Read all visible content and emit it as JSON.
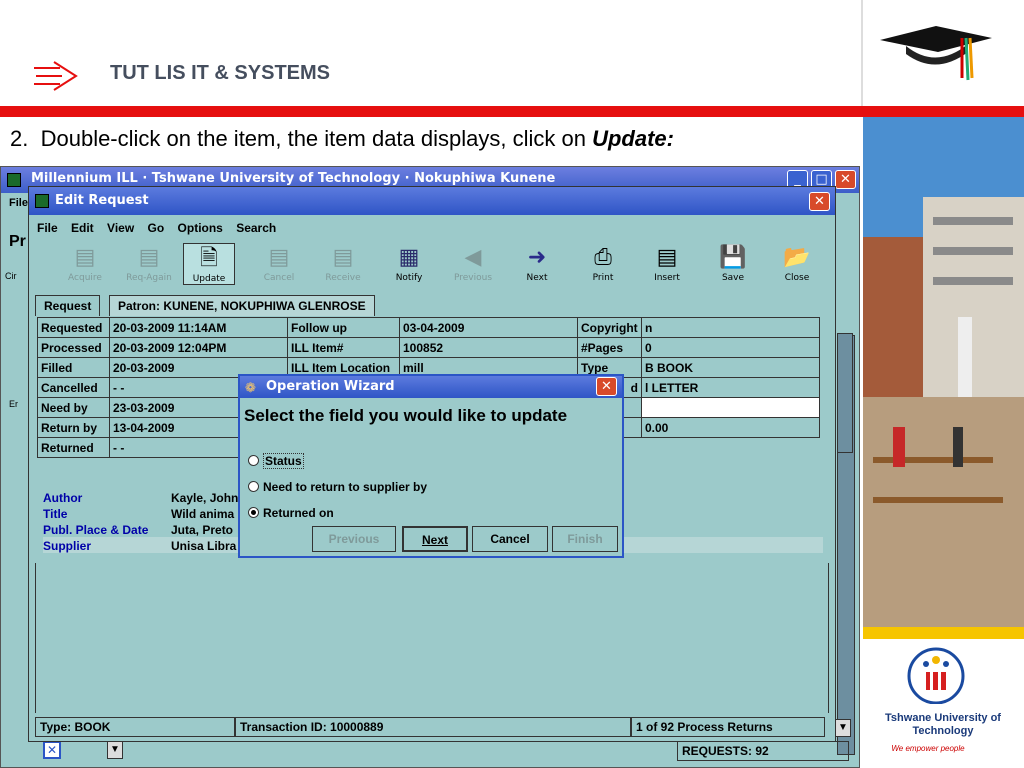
{
  "slide": {
    "title": "TUT LIS IT & SYSTEMS",
    "step_num": "2.",
    "step_text": "Double-click on the item, the item data displays, click on",
    "step_emph": "Update:",
    "logo_name": "Tshwane University of Technology",
    "logo_tagline": "We empower people"
  },
  "window": {
    "title": "Millennium ILL · Tshwane University of Technology · Nokuphiwa Kunene",
    "left_fragments": [
      "File",
      "Pr",
      "Cir",
      "Er"
    ]
  },
  "dialog": {
    "title": "Edit Request",
    "menu": [
      "File",
      "Edit",
      "View",
      "Go",
      "Options",
      "Search"
    ],
    "toolbar": [
      {
        "label": "Acquire",
        "icon": "acquire-icon",
        "state": "disabled"
      },
      {
        "label": "Req-Again",
        "icon": "req-again-icon",
        "state": "disabled"
      },
      {
        "label": "Update",
        "icon": "update-icon",
        "state": "active"
      },
      {
        "label": "Cancel",
        "icon": "cancel-icon",
        "state": "disabled"
      },
      {
        "label": "Receive",
        "icon": "receive-icon",
        "state": "disabled"
      },
      {
        "label": "Notify",
        "icon": "notify-icon",
        "state": "enabled"
      },
      {
        "label": "Previous",
        "icon": "previous-icon",
        "state": "disabled"
      },
      {
        "label": "Next",
        "icon": "next-icon",
        "state": "enabled"
      },
      {
        "label": "Print",
        "icon": "print-icon",
        "state": "enabled"
      },
      {
        "label": "Insert",
        "icon": "insert-icon",
        "state": "enabled"
      },
      {
        "label": "Save",
        "icon": "save-icon",
        "state": "enabled"
      },
      {
        "label": "Close",
        "icon": "close-icon",
        "state": "enabled"
      }
    ],
    "tabs": [
      "Request",
      "Patron: KUNENE, NOKUPHIWA GLENROSE"
    ],
    "rows": [
      [
        "Requested",
        "20-03-2009 11:14AM",
        "Follow up",
        "03-04-2009",
        "Copyright",
        "n"
      ],
      [
        "Processed",
        "20-03-2009 12:04PM",
        "ILL Item#",
        "100852",
        "#Pages",
        "0"
      ],
      [
        "Filled",
        "20-03-2009",
        "ILL Item Location",
        "mill",
        "Type",
        "B BOOK"
      ],
      [
        "Cancelled",
        "- -",
        "",
        "",
        "d",
        "l LETTER"
      ],
      [
        "Need by",
        "23-03-2009",
        "",
        "",
        "",
        ""
      ],
      [
        "Return by",
        "13-04-2009",
        "",
        "",
        "",
        "0.00"
      ],
      [
        "Returned",
        "- -",
        "",
        "",
        "",
        ""
      ]
    ],
    "bib": [
      {
        "label": "Author",
        "value": "Kayle, John"
      },
      {
        "label": "Title",
        "value": "Wild anima"
      },
      {
        "label": "Publ. Place & Date",
        "value": "Juta, Preto"
      },
      {
        "label": "Supplier",
        "value": "Unisa Libra"
      }
    ],
    "status": {
      "type": "Type: BOOK",
      "transaction": "Transaction ID: 10000889",
      "process": "1 of 92 Process Returns",
      "requests": "REQUESTS: 92"
    }
  },
  "wizard": {
    "title": "Operation Wizard",
    "heading": "Select the field you would like to update",
    "options": [
      {
        "label": "Status",
        "selected": false
      },
      {
        "label": "Need to return to supplier by",
        "selected": false
      },
      {
        "label": "Returned on",
        "selected": true
      }
    ],
    "buttons": {
      "previous": "Previous",
      "next": "Next",
      "cancel": "Cancel",
      "finish": "Finish"
    }
  },
  "colors": {
    "red_bar": "#e60f0f",
    "title_bar": "#3c5ec9",
    "panel": "#9ccaca",
    "yellow_bar": "#f6c500"
  }
}
